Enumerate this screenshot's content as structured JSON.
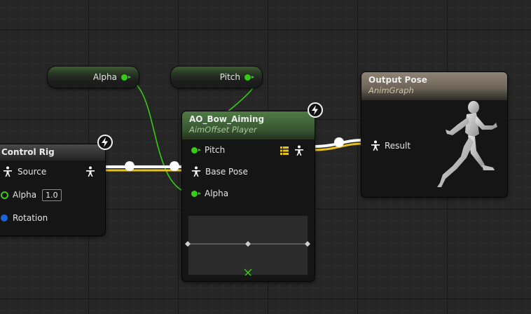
{
  "variables": {
    "alpha_label": "Alpha",
    "pitch_label": "Pitch"
  },
  "control_rig_node": {
    "title": "Control Rig",
    "pins": {
      "source": "Source",
      "alpha": "Alpha",
      "alpha_value": "1.0",
      "rotation": "Rotation"
    }
  },
  "aim_offset_node": {
    "title": "AO_Bow_Aiming",
    "subtitle": "AimOffset Player",
    "pins": {
      "pitch": "Pitch",
      "base_pose": "Base Pose",
      "alpha": "Alpha"
    }
  },
  "output_pose_node": {
    "title": "Output Pose",
    "subtitle": "AnimGraph",
    "pins": {
      "result": "Result"
    }
  },
  "colors": {
    "exec_green": "#35cc13",
    "pose_white": "#ffffff",
    "pose_yellow": "#e8c21c",
    "float_blue": "#1e64d8",
    "aim_header": "#3f6b3b",
    "output_header": "#7d7466"
  },
  "icons": [
    "lightning-icon",
    "pose-figure-icon",
    "grid-list-icon",
    "x-marker-icon",
    "mannequin-icon"
  ]
}
